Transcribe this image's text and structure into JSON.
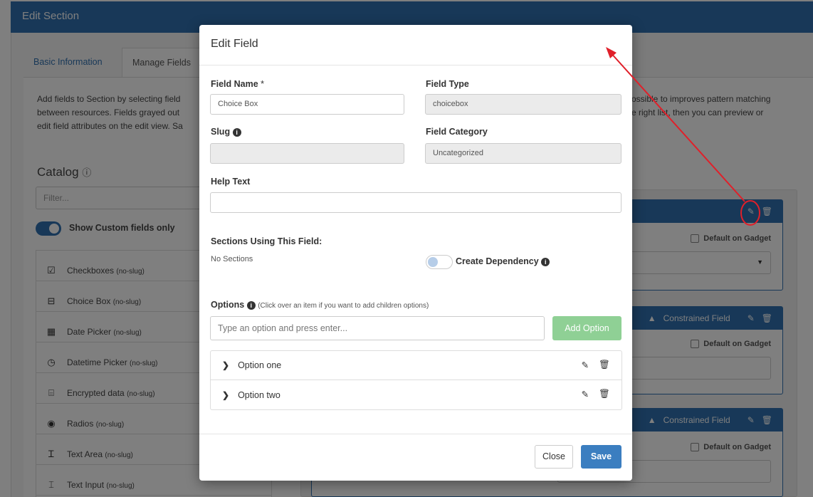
{
  "page": {
    "header_title": "Edit Section",
    "tabs": [
      {
        "label": "Basic Information"
      },
      {
        "label": "Manage Fields"
      }
    ],
    "description_left": "Add fields to Section by selecting field\nbetween resources. Fields grayed out\nedit field attributes on the edit view. Sa",
    "description_right": "ossible to improves pattern matching\ne right list, then you can preview or",
    "catalog_title": "Catalog",
    "filter_placeholder": "Filter...",
    "custom_toggle_label": "Show Custom fields only",
    "catalog_items": [
      {
        "name": "Checkboxes",
        "slug": "(no-slug)",
        "icon": "checkbox-icon"
      },
      {
        "name": "Choice Box",
        "slug": "(no-slug)",
        "icon": "choice-box-icon"
      },
      {
        "name": "Date Picker",
        "slug": "(no-slug)",
        "icon": "calendar-icon"
      },
      {
        "name": "Datetime Picker",
        "slug": "(no-slug)",
        "icon": "calendar-clock-icon"
      },
      {
        "name": "Encrypted data",
        "slug": "(no-slug)",
        "icon": "encrypted-icon"
      },
      {
        "name": "Radios",
        "slug": "(no-slug)",
        "icon": "radio-icon"
      },
      {
        "name": "Text Area",
        "slug": "(no-slug)",
        "icon": "text-area-icon"
      },
      {
        "name": "Text Input",
        "slug": "(no-slug)",
        "icon": "text-input-icon"
      }
    ],
    "right_panels": [
      {
        "badge": "",
        "default_label": "Default on Gadget"
      },
      {
        "badge": "Constrained Field",
        "default_label": "Default on Gadget"
      },
      {
        "badge": "Constrained Field",
        "default_label": "Default on Gadget"
      }
    ]
  },
  "modal": {
    "title": "Edit Field",
    "field_name_label": "Field Name",
    "field_name_required": "*",
    "field_name_value": "Choice Box",
    "field_type_label": "Field Type",
    "field_type_value": "choicebox",
    "slug_label": "Slug",
    "slug_value": "",
    "field_category_label": "Field Category",
    "field_category_value": "Uncategorized",
    "help_text_label": "Help Text",
    "help_text_value": "",
    "sections_label": "Sections Using This Field:",
    "sections_value": "No Sections",
    "dependency_label": "Create Dependency",
    "options_label": "Options",
    "options_hint": "(Click over an item if you want to add children options)",
    "option_input_placeholder": "Type an option and press enter...",
    "add_option_label": "Add Option",
    "options": [
      {
        "label": "Option one"
      },
      {
        "label": "Option two"
      }
    ],
    "close_label": "Close",
    "save_label": "Save"
  },
  "colors": {
    "primary": "#3071b0",
    "save_button": "#3b7ec0",
    "add_option_button": "#8fd095",
    "annotation": "#e0202a"
  }
}
